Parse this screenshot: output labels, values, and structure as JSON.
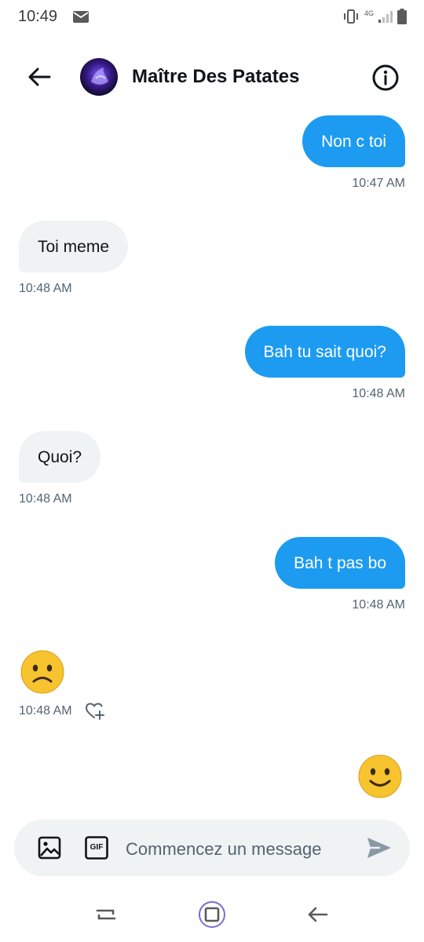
{
  "status_bar": {
    "time": "10:49",
    "network": "4G"
  },
  "header": {
    "contact_name": "Maître Des Patates"
  },
  "messages": [
    {
      "side": "sent",
      "text": "Non c toi",
      "time": "10:47 AM"
    },
    {
      "side": "received",
      "text": "Toi meme",
      "time": "10:48 AM"
    },
    {
      "side": "sent",
      "text": "Bah tu sait quoi?",
      "time": "10:48 AM"
    },
    {
      "side": "received",
      "text": "Quoi?",
      "time": "10:48 AM"
    },
    {
      "side": "sent",
      "text": "Bah t pas bo",
      "time": "10:48 AM"
    },
    {
      "side": "received",
      "text": "",
      "emoji": "slightly-frowning-face",
      "time": "10:48 AM"
    },
    {
      "side": "sent",
      "text": "",
      "emoji": "slightly-smiling-face",
      "time": ""
    }
  ],
  "composer": {
    "placeholder": "Commencez un message",
    "gif_label": "GIF"
  },
  "colors": {
    "accent": "#1d9bf0",
    "received_bubble": "#eff3f4",
    "timestamp": "#536471"
  },
  "icons": [
    "mail-icon",
    "vibrate-icon",
    "signal-icon",
    "battery-icon",
    "back-arrow-icon",
    "info-icon",
    "image-icon",
    "gif-icon",
    "send-icon",
    "react-heart-icon",
    "recents-nav-icon",
    "home-nav-icon",
    "back-nav-icon"
  ]
}
